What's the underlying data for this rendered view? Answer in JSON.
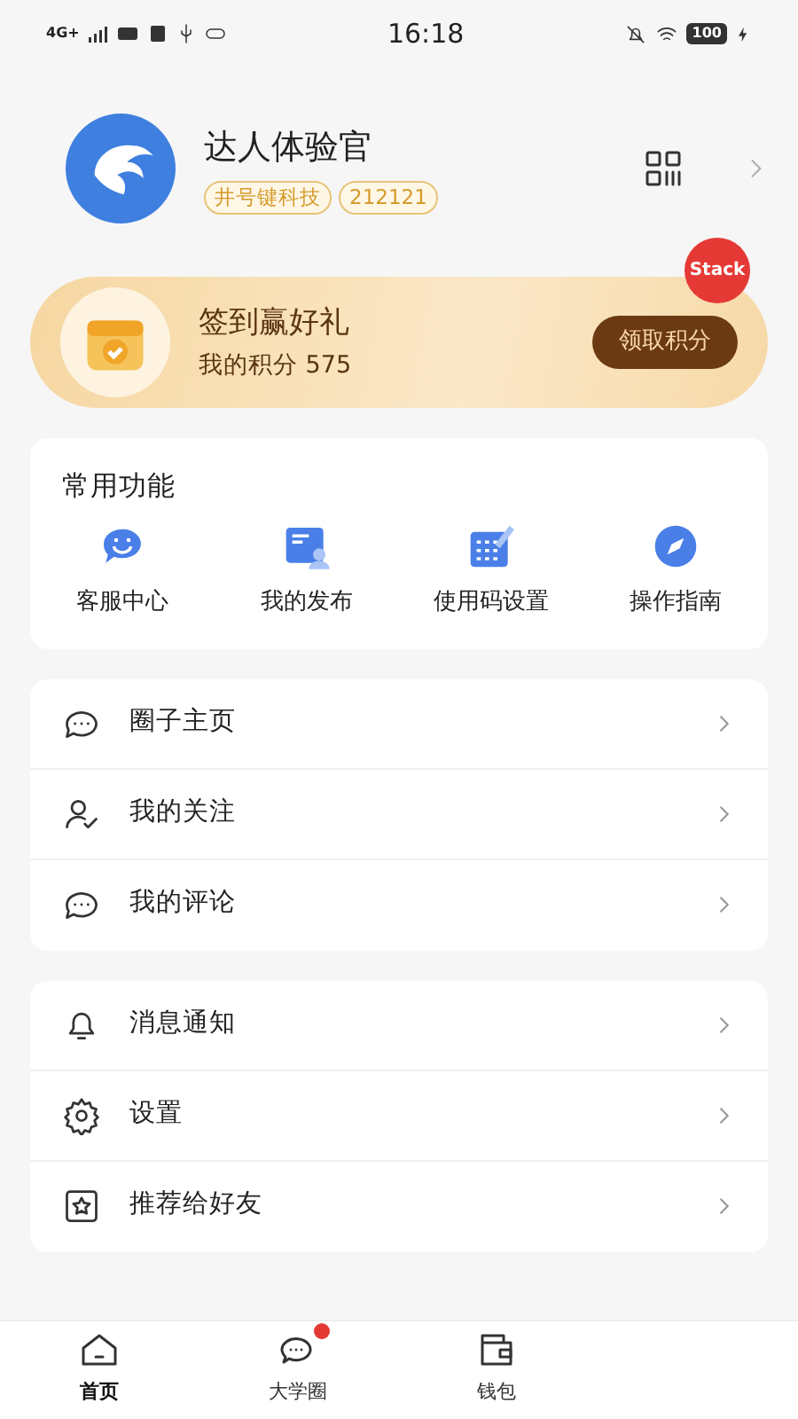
{
  "status_bar": {
    "time": "16:18",
    "network": "4G+",
    "battery": "100"
  },
  "profile": {
    "name": "达人体验官",
    "tags": [
      "井号键科技",
      "212121"
    ]
  },
  "stack_badge": "Stack",
  "checkin": {
    "title": "签到赢好礼",
    "points_label": "我的积分 575",
    "button": "领取积分"
  },
  "functions": {
    "title": "常用功能",
    "items": [
      {
        "kind": "service",
        "label": "客服中心"
      },
      {
        "kind": "posts",
        "label": "我的发布"
      },
      {
        "kind": "code",
        "label": "使用码设置"
      },
      {
        "kind": "guide",
        "label": "操作指南"
      }
    ]
  },
  "menu_groups": [
    [
      {
        "kind": "chat",
        "label": "圈子主页"
      },
      {
        "kind": "follow",
        "label": "我的关注"
      },
      {
        "kind": "comment",
        "label": "我的评论"
      }
    ],
    [
      {
        "kind": "bell",
        "label": "消息通知"
      },
      {
        "kind": "gear",
        "label": "设置"
      },
      {
        "kind": "star",
        "label": "推荐给好友"
      }
    ]
  ],
  "tab_bar": [
    {
      "kind": "home",
      "label": "首页",
      "selected": true,
      "badge": false
    },
    {
      "kind": "chat",
      "label": "大学圈",
      "selected": false,
      "badge": true
    },
    {
      "kind": "wallet",
      "label": "钱包",
      "selected": false,
      "badge": false
    }
  ]
}
